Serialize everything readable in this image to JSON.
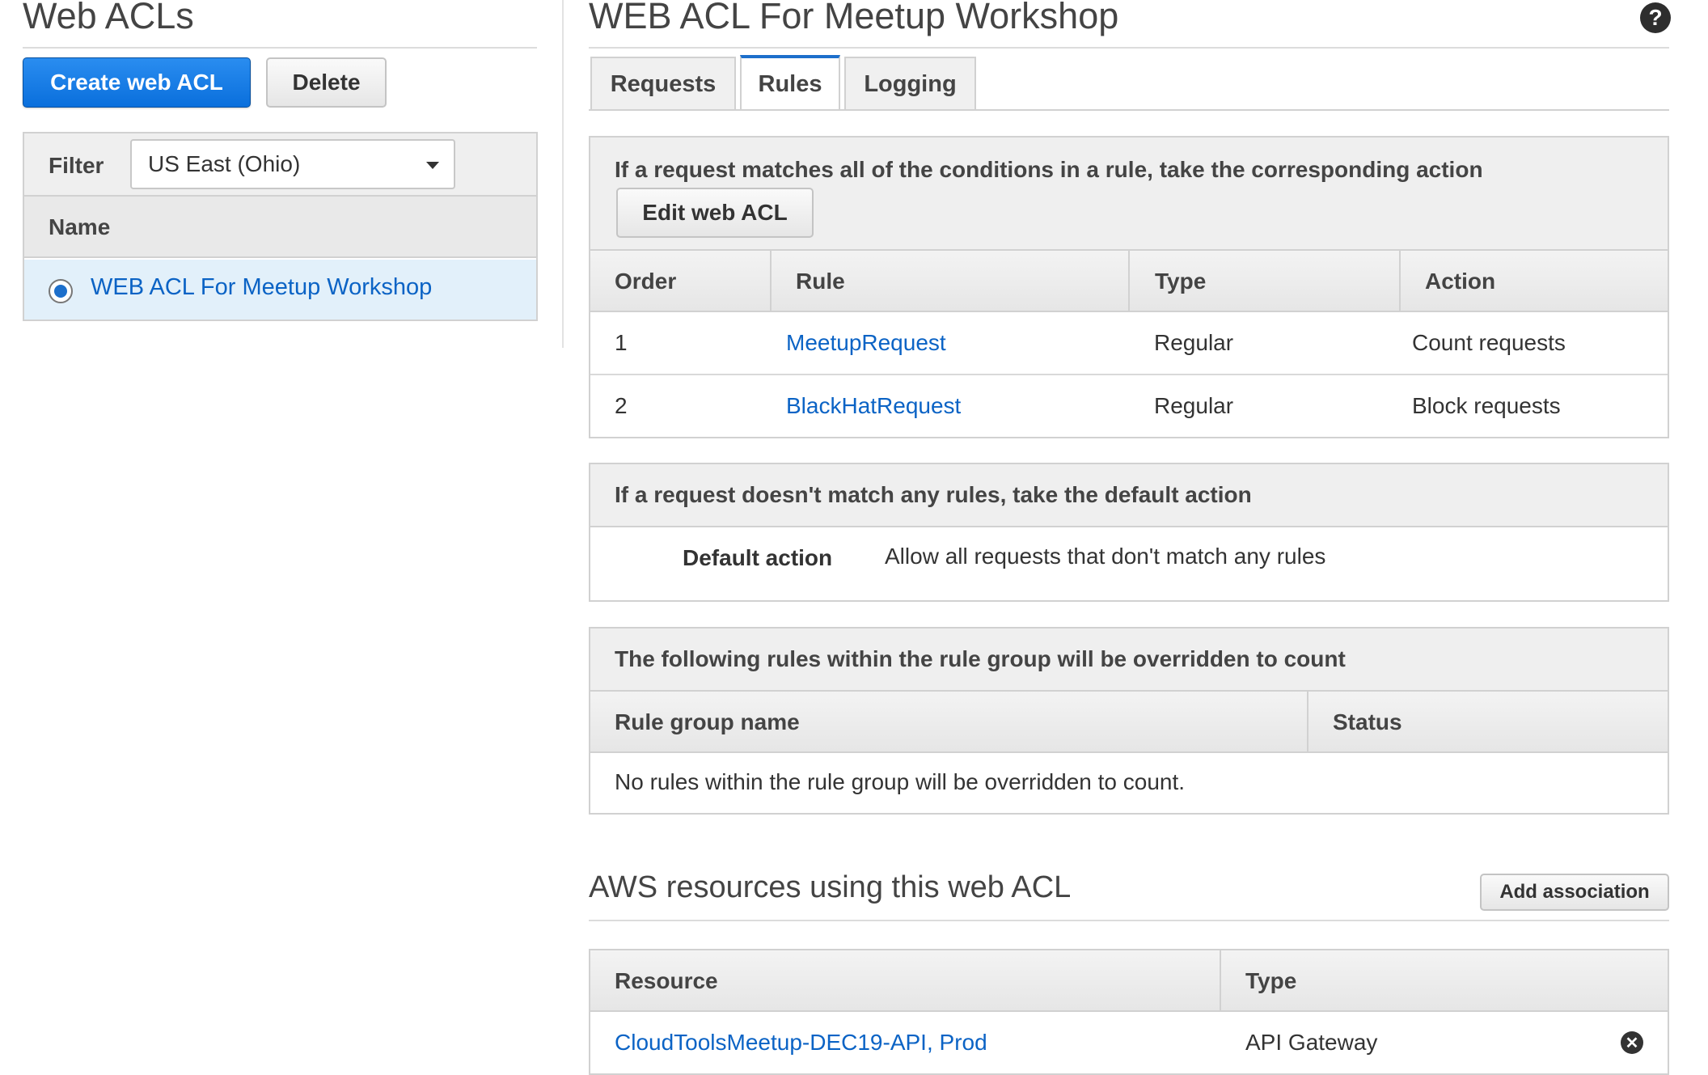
{
  "sidebar": {
    "title": "Web ACLs",
    "create_label": "Create web ACL",
    "delete_label": "Delete",
    "filter_label": "Filter",
    "filter_value": "US East (Ohio)",
    "name_header": "Name",
    "items": [
      {
        "label": "WEB ACL For Meetup Workshop",
        "selected": true
      }
    ]
  },
  "main": {
    "title": "WEB ACL For Meetup Workshop",
    "tabs": [
      {
        "label": "Requests"
      },
      {
        "label": "Rules",
        "active": true
      },
      {
        "label": "Logging"
      }
    ],
    "rules_panel": {
      "heading": "If a request matches all of the conditions in a rule, take the corresponding action",
      "edit_label": "Edit web ACL",
      "columns": [
        "Order",
        "Rule",
        "Type",
        "Action"
      ],
      "rows": [
        {
          "order": "1",
          "rule": "MeetupRequest",
          "type": "Regular",
          "action": "Count requests"
        },
        {
          "order": "2",
          "rule": "BlackHatRequest",
          "type": "Regular",
          "action": "Block requests"
        }
      ]
    },
    "default_panel": {
      "heading": "If a request doesn't match any rules, take the default action",
      "label": "Default action",
      "value": "Allow all requests that don't match any rules"
    },
    "override_panel": {
      "heading": "The following rules within the rule group will be overridden to count",
      "columns": [
        "Rule group name",
        "Status"
      ],
      "empty_text": "No rules within the rule group will be overridden to count."
    },
    "resources": {
      "title": "AWS resources using this web ACL",
      "add_label": "Add association",
      "columns": [
        "Resource",
        "Type"
      ],
      "rows": [
        {
          "resource": "CloudToolsMeetup-DEC19-API, Prod",
          "type": "API Gateway"
        }
      ]
    }
  },
  "colors": {
    "accent": "#1d6fcb",
    "link": "#0b63c5",
    "selected_row": "#e2f0fa"
  }
}
